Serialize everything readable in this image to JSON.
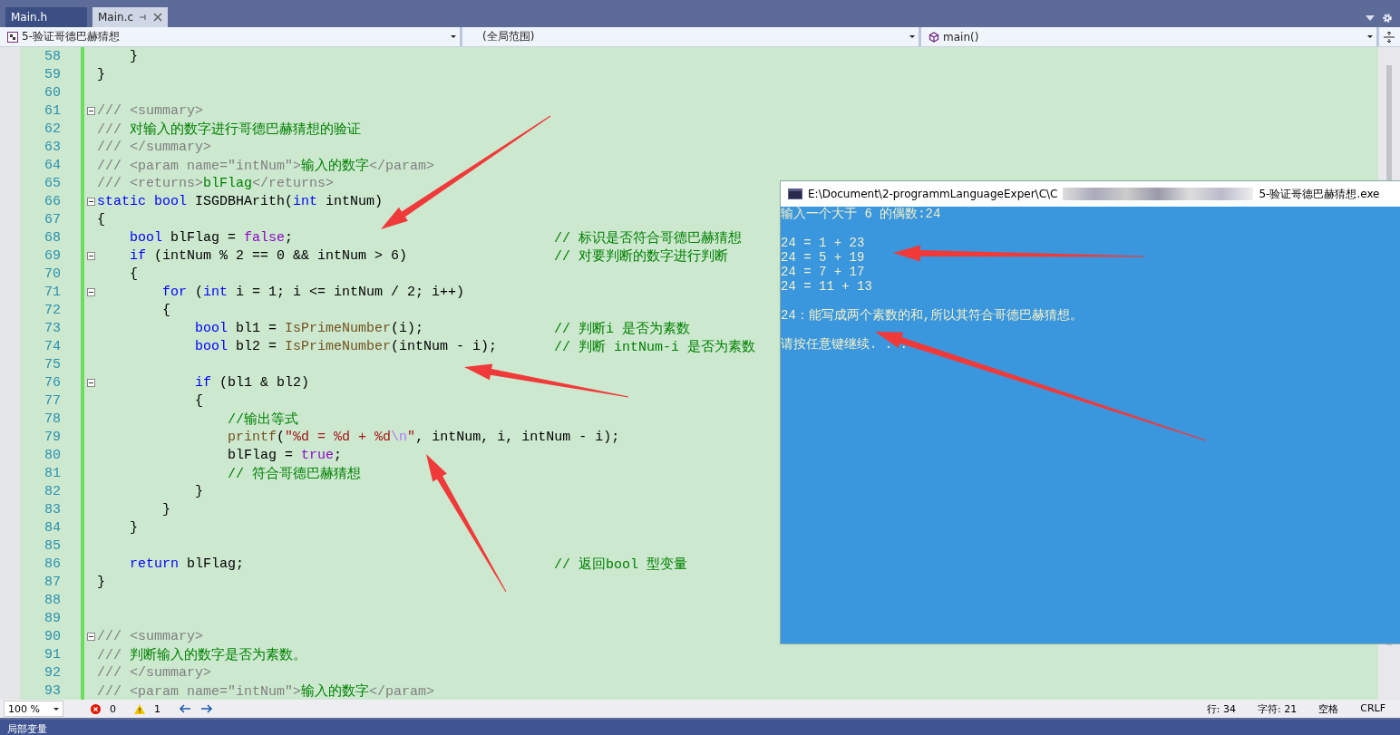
{
  "tabs": [
    {
      "label": "Main.h",
      "selected": false
    },
    {
      "label": "Main.c",
      "selected": true
    }
  ],
  "navigation": {
    "project": "5-验证哥德巴赫猜想",
    "scope": "(全局范围)",
    "member": "main()"
  },
  "code_lines": [
    {
      "number": "58",
      "foldable": false,
      "tokens": [
        {
          "kind": "plain",
          "text": "    }"
        }
      ]
    },
    {
      "number": "59",
      "foldable": false,
      "tokens": [
        {
          "kind": "plain",
          "text": "}"
        }
      ]
    },
    {
      "number": "60",
      "foldable": false
    },
    {
      "number": "61",
      "foldable": true,
      "tokens": [
        {
          "kind": "doc",
          "text": "/// <summary>"
        }
      ]
    },
    {
      "number": "62",
      "foldable": false,
      "tokens": [
        {
          "kind": "doc",
          "text": "/// "
        },
        {
          "kind": "comment",
          "text": "对输入的数字进行哥德巴赫猜想的验证"
        }
      ]
    },
    {
      "number": "63",
      "foldable": false,
      "tokens": [
        {
          "kind": "doc",
          "text": "/// </summary>"
        }
      ]
    },
    {
      "number": "64",
      "foldable": false,
      "tokens": [
        {
          "kind": "doc",
          "text": "/// <param name=\"intNum\">"
        },
        {
          "kind": "comment",
          "text": "输入的数字"
        },
        {
          "kind": "doc",
          "text": "</param>"
        }
      ]
    },
    {
      "number": "65",
      "foldable": false,
      "tokens": [
        {
          "kind": "doc",
          "text": "/// <returns>"
        },
        {
          "kind": "comment",
          "text": "blFlag"
        },
        {
          "kind": "doc",
          "text": "</returns>"
        }
      ]
    },
    {
      "number": "66",
      "foldable": true,
      "tokens": [
        {
          "kind": "keyword",
          "text": "static bool "
        },
        {
          "kind": "plain",
          "text": "ISGDBHArith("
        },
        {
          "kind": "keyword",
          "text": "int"
        },
        {
          "kind": "plain",
          "text": " intNum)"
        }
      ]
    },
    {
      "number": "67",
      "foldable": false,
      "tokens": [
        {
          "kind": "plain",
          "text": "{"
        }
      ]
    },
    {
      "number": "68",
      "foldable": false,
      "tokens": [
        {
          "kind": "keyword",
          "text": "    bool"
        },
        {
          "kind": "plain",
          "text": " blFlag = "
        },
        {
          "kind": "value",
          "text": "false"
        },
        {
          "kind": "plain",
          "text": ";"
        }
      ],
      "note": "// 标识是否符合哥德巴赫猜想"
    },
    {
      "number": "69",
      "foldable": true,
      "tokens": [
        {
          "kind": "keyword",
          "text": "    if"
        },
        {
          "kind": "plain",
          "text": " (intNum % 2 == 0 && intNum > 6)"
        }
      ],
      "note": "// 对要判断的数字进行判断"
    },
    {
      "number": "70",
      "foldable": false,
      "tokens": [
        {
          "kind": "plain",
          "text": "    {"
        }
      ]
    },
    {
      "number": "71",
      "foldable": true,
      "tokens": [
        {
          "kind": "keyword",
          "text": "        for"
        },
        {
          "kind": "plain",
          "text": " ("
        },
        {
          "kind": "keyword",
          "text": "int"
        },
        {
          "kind": "plain",
          "text": " i = 1; i <= intNum / 2; i++)"
        }
      ]
    },
    {
      "number": "72",
      "foldable": false,
      "tokens": [
        {
          "kind": "plain",
          "text": "        {"
        }
      ]
    },
    {
      "number": "73",
      "foldable": false,
      "tokens": [
        {
          "kind": "keyword",
          "text": "            bool"
        },
        {
          "kind": "plain",
          "text": " bl1 = "
        },
        {
          "kind": "function",
          "text": "IsPrimeNumber"
        },
        {
          "kind": "plain",
          "text": "(i);"
        }
      ],
      "note": "// 判断i 是否为素数"
    },
    {
      "number": "74",
      "foldable": false,
      "tokens": [
        {
          "kind": "keyword",
          "text": "            bool"
        },
        {
          "kind": "plain",
          "text": " bl2 = "
        },
        {
          "kind": "function",
          "text": "IsPrimeNumber"
        },
        {
          "kind": "plain",
          "text": "(intNum - i);"
        }
      ],
      "note": "// 判断 intNum-i 是否为素数"
    },
    {
      "number": "75",
      "foldable": false
    },
    {
      "number": "76",
      "foldable": true,
      "tokens": [
        {
          "kind": "keyword",
          "text": "            if"
        },
        {
          "kind": "plain",
          "text": " (bl1 & bl2)"
        }
      ]
    },
    {
      "number": "77",
      "foldable": false,
      "tokens": [
        {
          "kind": "plain",
          "text": "            {"
        }
      ]
    },
    {
      "number": "78",
      "foldable": false,
      "tokens": [
        {
          "kind": "comment",
          "text": "                //输出等式"
        }
      ]
    },
    {
      "number": "79",
      "foldable": false,
      "tokens": [
        {
          "kind": "function",
          "text": "                printf"
        },
        {
          "kind": "plain",
          "text": "("
        },
        {
          "kind": "string",
          "text": "\"%d = %d + %d"
        },
        {
          "kind": "escape",
          "text": "\\n"
        },
        {
          "kind": "string",
          "text": "\""
        },
        {
          "kind": "plain",
          "text": ", intNum, i, intNum - i);"
        }
      ]
    },
    {
      "number": "80",
      "foldable": false,
      "tokens": [
        {
          "kind": "plain",
          "text": "                blFlag = "
        },
        {
          "kind": "value",
          "text": "true"
        },
        {
          "kind": "plain",
          "text": ";"
        }
      ]
    },
    {
      "number": "81",
      "foldable": false,
      "tokens": [
        {
          "kind": "comment",
          "text": "                // 符合哥德巴赫猜想"
        }
      ]
    },
    {
      "number": "82",
      "foldable": false,
      "tokens": [
        {
          "kind": "plain",
          "text": "            }"
        }
      ]
    },
    {
      "number": "83",
      "foldable": false,
      "tokens": [
        {
          "kind": "plain",
          "text": "        }"
        }
      ]
    },
    {
      "number": "84",
      "foldable": false,
      "tokens": [
        {
          "kind": "plain",
          "text": "    }"
        }
      ]
    },
    {
      "number": "85",
      "foldable": false
    },
    {
      "number": "86",
      "foldable": false,
      "tokens": [
        {
          "kind": "keyword",
          "text": "    return"
        },
        {
          "kind": "plain",
          "text": " blFlag;"
        }
      ],
      "note": "// 返回bool 型变量"
    },
    {
      "number": "87",
      "foldable": false,
      "tokens": [
        {
          "kind": "plain",
          "text": "}"
        }
      ]
    },
    {
      "number": "88",
      "foldable": false
    },
    {
      "number": "89",
      "foldable": false
    },
    {
      "number": "90",
      "foldable": true,
      "tokens": [
        {
          "kind": "doc",
          "text": "/// <summary>"
        }
      ]
    },
    {
      "number": "91",
      "foldable": false,
      "tokens": [
        {
          "kind": "doc",
          "text": "/// "
        },
        {
          "kind": "comment",
          "text": "判断输入的数字是否为素数。"
        }
      ]
    },
    {
      "number": "92",
      "foldable": false,
      "tokens": [
        {
          "kind": "doc",
          "text": "/// </summary>"
        }
      ]
    },
    {
      "number": "93",
      "foldable": false,
      "tokens": [
        {
          "kind": "doc",
          "text": "/// <param name=\"intNum\">"
        },
        {
          "kind": "comment",
          "text": "输入的数字"
        },
        {
          "kind": "doc",
          "text": "</param>"
        }
      ]
    }
  ],
  "console": {
    "title_start": "E:\\Document\\2-programmLanguageExper\\C\\C",
    "title_end": "5-验证哥德巴赫猜想.exe",
    "blocks": [
      [
        "输入一个大于 6 的偶数:24"
      ],
      [
        "24 = 1 + 23",
        "24 = 5 + 19",
        "24 = 7 + 17",
        "24 = 11 + 13"
      ],
      [
        "24：能写成两个素数的和,所以其符合哥德巴赫猜想。"
      ],
      [
        "请按任意键继续. . ."
      ]
    ]
  },
  "status_bar": {
    "zoom": "100 %",
    "errors": "0",
    "warnings": "1",
    "line": "行: 34",
    "char": "字符: 21",
    "indent": "空格",
    "line_ending": "CRLF"
  },
  "bottom_panel": {
    "title": "局部变量"
  }
}
